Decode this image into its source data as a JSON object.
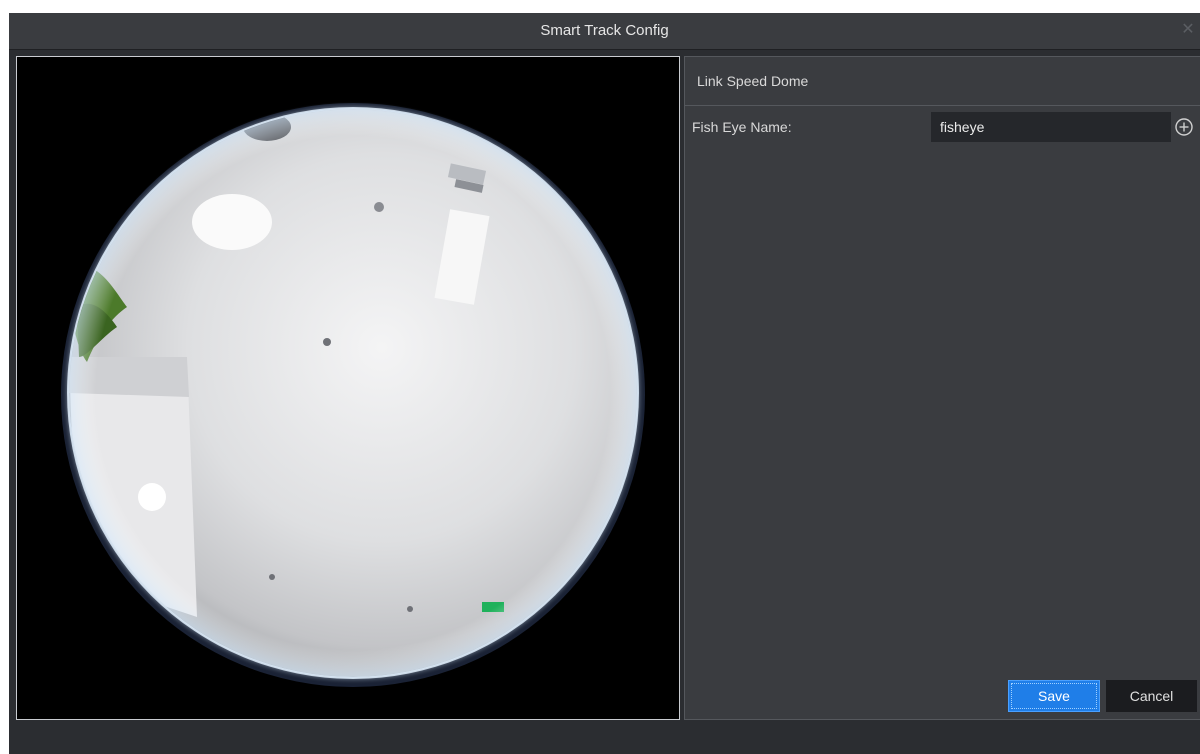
{
  "dialog": {
    "title": "Smart Track Config",
    "close_icon": "close-icon"
  },
  "video": {
    "icon": "fisheye-camera-view"
  },
  "panel": {
    "section_title": "Link Speed Dome",
    "fish_eye_name_label": "Fish Eye Name:",
    "fish_eye_name_value": "fisheye",
    "add_icon": "add-circle-icon"
  },
  "buttons": {
    "save_label": "Save",
    "cancel_label": "Cancel"
  },
  "colors": {
    "dialog_bg": "#2b2d31",
    "panel_bg": "#3a3c40",
    "accent": "#1f7ee8"
  }
}
